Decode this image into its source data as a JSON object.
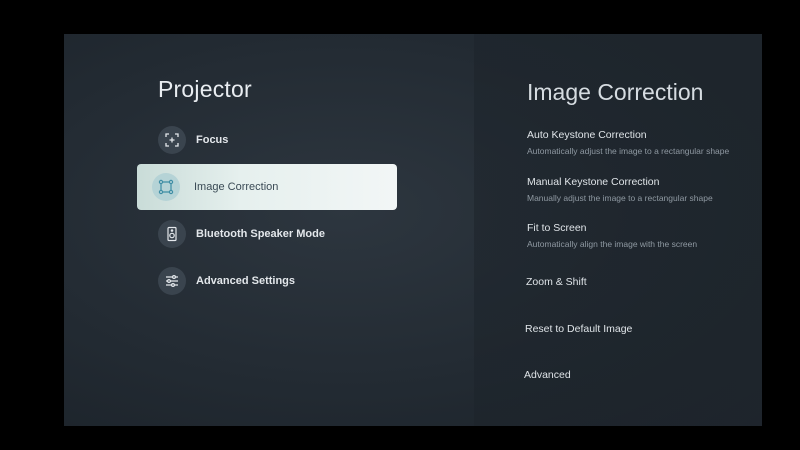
{
  "left": {
    "title": "Projector",
    "items": [
      {
        "label": "Focus",
        "icon": "focus-icon"
      },
      {
        "label": "Image Correction",
        "icon": "image-correction-icon",
        "selected": true
      },
      {
        "label": "Bluetooth Speaker Mode",
        "icon": "speaker-icon"
      },
      {
        "label": "Advanced Settings",
        "icon": "sliders-icon"
      }
    ]
  },
  "right": {
    "title": "Image Correction",
    "options": [
      {
        "label": "Auto Keystone Correction",
        "description": "Automatically adjust the image to a rectangular shape"
      },
      {
        "label": "Manual Keystone Correction",
        "description": "Manually adjust the image to a rectangular shape"
      },
      {
        "label": "Fit to Screen",
        "description": "Automatically align the image with the screen"
      },
      {
        "label": "Zoom & Shift"
      },
      {
        "label": "Reset to Default Image"
      },
      {
        "label": "Advanced"
      }
    ]
  },
  "colors": {
    "selected_bg": "#eef4f3",
    "icon_accent": "#4a9bb0",
    "text_primary": "#e3e7eb",
    "text_secondary": "#8f99a2"
  }
}
